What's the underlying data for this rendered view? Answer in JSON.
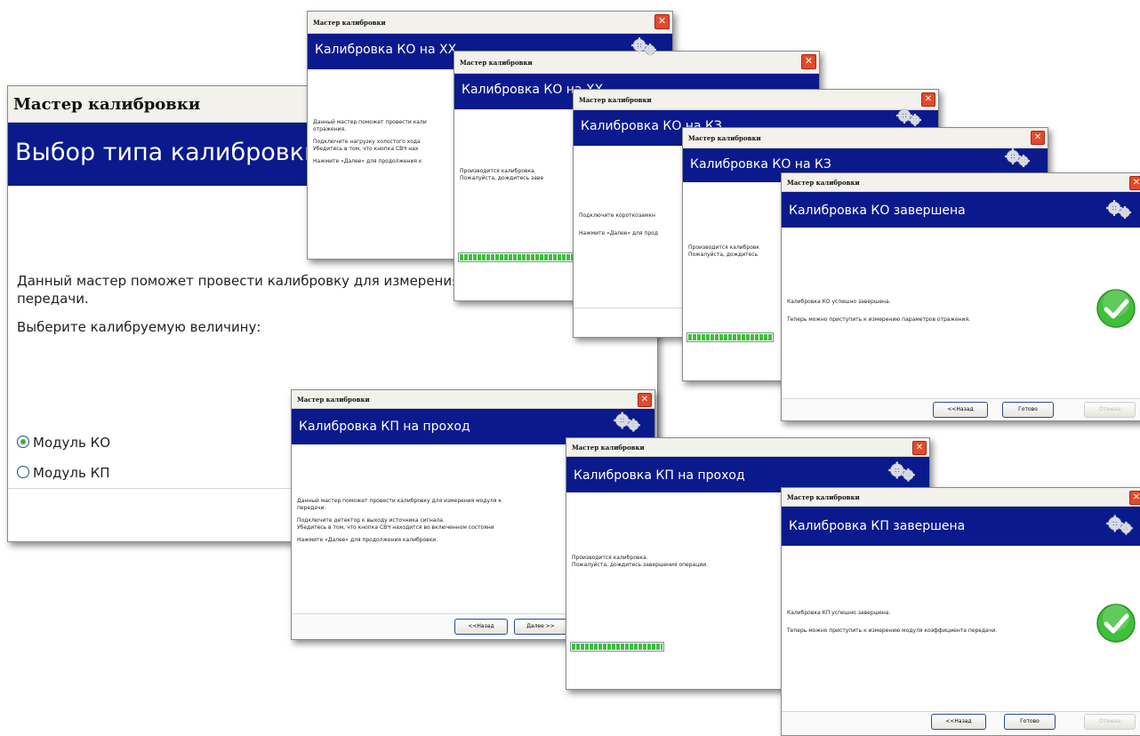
{
  "wizard_title": "Мастер калибровки",
  "next_label": "Далее >>",
  "back_label": "<<Назад",
  "done_label": "Готово",
  "cancel_label": "Отмена",
  "main": {
    "header": "Выбор типа калибровки",
    "line1": "Данный мастер поможет провести калибровку для измерения пар",
    "line2": "передачи.",
    "prompt": "Выберите калибруемую величину:",
    "options": [
      "Модуль КО",
      "Модуль КП"
    ]
  },
  "ko_xx": {
    "header": "Калибровка КО на ХХ",
    "lines": [
      "Данный мастер поможет провести кали",
      "отражения.",
      "",
      "Подключите нагрузку холостого хода",
      "Убедитесь в том, что кнопка СВЧ нах",
      "",
      "Нажмите «Далее» для продолжения к"
    ]
  },
  "ko_xx_progress": {
    "header": "Калибровка КО на ХХ",
    "lines": [
      "Производится калибровка.",
      "Пожалуйста, дождитесь заве"
    ]
  },
  "ko_kz": {
    "header": "Калибровка КО на КЗ",
    "lines": [
      "Подключите короткозамкн",
      "",
      "Нажмите «Далее» для прод"
    ]
  },
  "ko_kz_progress": {
    "header": "Калибровка КО на КЗ",
    "lines": [
      "Производится калибровк",
      "Пожалуйста, дождитесь"
    ]
  },
  "ko_done": {
    "header": "Калибровка КО завершена",
    "lines": [
      "Калибровка КО успешно завершена.",
      "",
      "Теперь можно приступить к измерению параметров отражения."
    ]
  },
  "kp": {
    "header": "Калибровка КП на проход",
    "lines": [
      "Данный мастер поможет провести калибровку для измерения модуля к",
      "передачи.",
      "",
      "Подключите детектор к выходу источника сигнала.",
      "Убедитесь в том, что кнопка СВЧ находится во включенном состояни",
      "",
      "Нажмите «Далее» для продолжения калибровки."
    ]
  },
  "kp_progress": {
    "header": "Калибровка КП на проход",
    "lines": [
      "Производится калибровка.",
      "Пожалуйста, дождитесь завершения операции."
    ]
  },
  "kp_done": {
    "header": "Калибровка КП завершена",
    "lines": [
      "Калибровка КП успешно завершена.",
      "",
      "Теперь можно приступить к измерению модуля коэффициента передачи."
    ]
  },
  "icons": {
    "gears": "gears-icon",
    "check": "check-circle-icon",
    "close": "close-icon"
  },
  "colors": {
    "header_bg": "#0a1a8c",
    "close_btn": "#e24a2c",
    "progress": "#3fbf3a",
    "check": "#3fbf3a"
  }
}
